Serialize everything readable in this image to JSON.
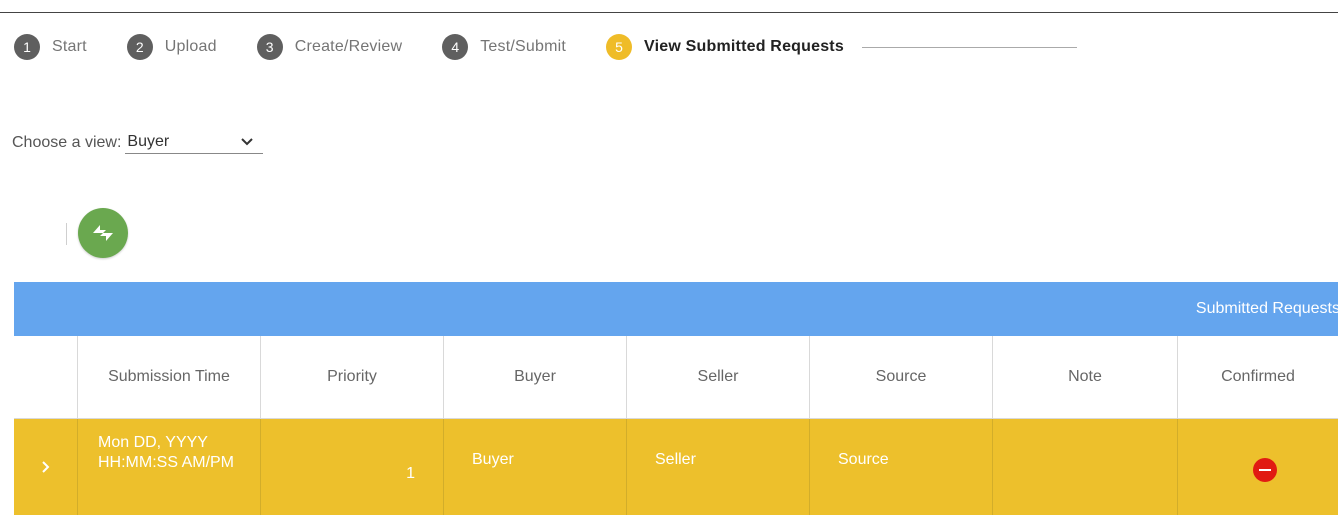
{
  "stepper": {
    "steps": [
      {
        "num": "1",
        "label": "Start"
      },
      {
        "num": "2",
        "label": "Upload"
      },
      {
        "num": "3",
        "label": "Create/Review"
      },
      {
        "num": "4",
        "label": "Test/Submit"
      },
      {
        "num": "5",
        "label": "View Submitted Requests"
      }
    ],
    "active_step": 5
  },
  "view": {
    "label": "Choose a view:",
    "selected": "Buyer"
  },
  "table": {
    "title": "Submitted Requests",
    "columns": [
      "",
      "Submission Time",
      "Priority",
      "Buyer",
      "Seller",
      "Source",
      "Note",
      "Confirmed"
    ],
    "rows": [
      {
        "submission_time": "Mon DD, YYYY HH:MM:SS AM/PM",
        "priority": "1",
        "buyer": "Buyer",
        "seller": "Seller",
        "source": "Source",
        "note": "",
        "confirmed_icon": "minus-circle-icon"
      }
    ]
  },
  "colors": {
    "header_bar": "#64a5ee",
    "row_highlight": "#edc02c",
    "active_step": "#efbc28",
    "refresh": "#6aa84f",
    "negative": "#e11b12"
  }
}
